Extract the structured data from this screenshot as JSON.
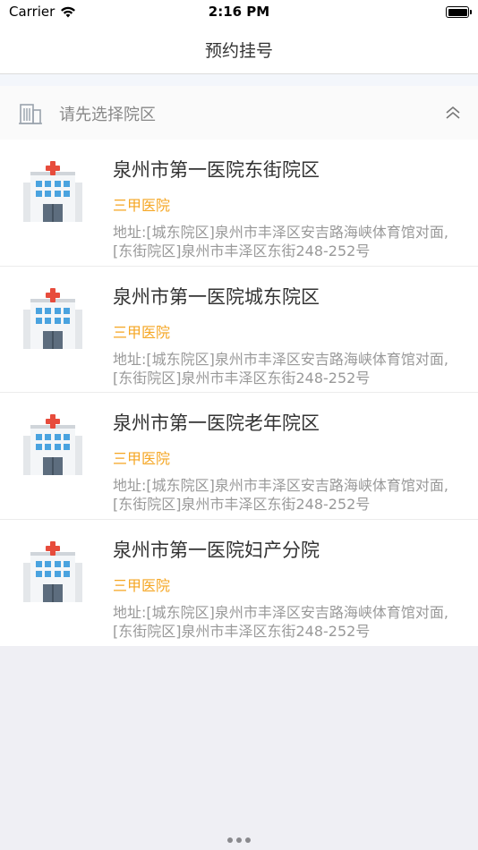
{
  "status_bar": {
    "carrier": "Carrier",
    "time": "2:16 PM",
    "battery_level": 1.0
  },
  "nav": {
    "title": "预约挂号"
  },
  "selector": {
    "label": "请先选择院区",
    "icon": "building-icon",
    "chevron": "chevron-up-double-icon"
  },
  "hospitals": [
    {
      "name": "泉州市第一医院东街院区",
      "level": "三甲医院",
      "address": "地址:[城东院区]泉州市丰泽区安吉路海峡体育馆对面,[东街院区]泉州市丰泽区东街248-252号"
    },
    {
      "name": "泉州市第一医院城东院区",
      "level": "三甲医院",
      "address": "地址:[城东院区]泉州市丰泽区安吉路海峡体育馆对面,[东街院区]泉州市丰泽区东街248-252号"
    },
    {
      "name": "泉州市第一医院老年院区",
      "level": "三甲医院",
      "address": "地址:[城东院区]泉州市丰泽区安吉路海峡体育馆对面,[东街院区]泉州市丰泽区东街248-252号"
    },
    {
      "name": "泉州市第一医院妇产分院",
      "level": "三甲医院",
      "address": "地址:[城东院区]泉州市丰泽区安吉路海峡体育馆对面,[东街院区]泉州市丰泽区东街248-252号"
    }
  ],
  "colors": {
    "level": "#f5a623",
    "text_primary": "#333333",
    "text_secondary": "#999999",
    "background": "#efeff4"
  }
}
